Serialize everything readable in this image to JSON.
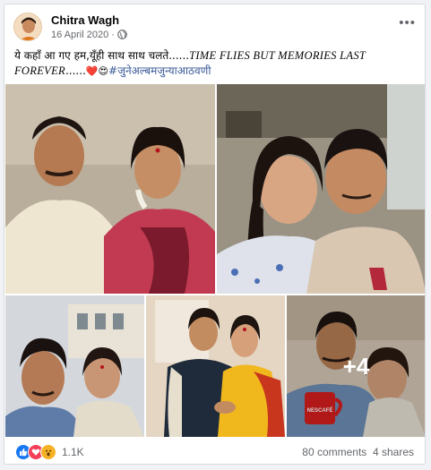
{
  "post": {
    "author": "Chitra Wagh",
    "date": "16 April 2020",
    "separator": "·",
    "more_label": "•••",
    "caption_main": "ये कहाँ आ गए हम,यूँही साथ साथ चलते......",
    "caption_italic": "TIME FLIES BUT MEMORIES LAST FOREVER",
    "caption_dots": "......",
    "caption_emojis": "❤️😍",
    "hashtag": "#जुनेअल्बमजुन्याआठवणी"
  },
  "photos": {
    "more_overlay": "+4",
    "mug_text": "NESCAFÉ"
  },
  "footer": {
    "reaction_icons": [
      "like-icon",
      "love-icon",
      "wow-icon"
    ],
    "reaction_count": "1.1K",
    "comments": "80 comments",
    "shares": "4 shares"
  },
  "colors": {
    "like": "#1877f2",
    "love": "#f33e58",
    "wow": "#f7b125",
    "hashtag": "#385898",
    "meta": "#65676b"
  }
}
